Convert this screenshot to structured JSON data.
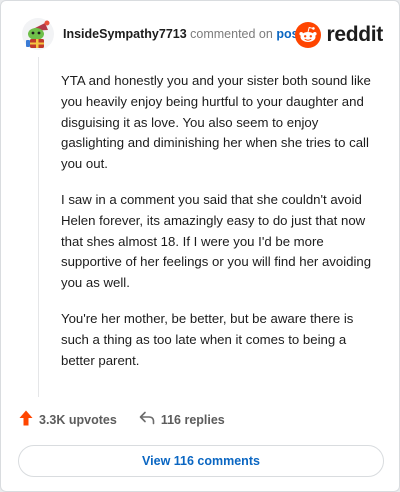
{
  "comment": {
    "username": "InsideSympathy7713",
    "action_text": "commented on",
    "post_link": "post",
    "paragraphs": [
      "YTA and honestly you and your sister both sound like you heavily enjoy being hurtful to your daughter and disguising it as love. You also seem to enjoy gaslighting and diminishing her when she tries to call you out.",
      "I saw in a comment you said that she couldn't avoid Helen forever, its amazingly easy to do just that now that shes almost 18. If I were you I'd be more supportive of her feelings or you will find her avoiding you as well.",
      "You're her mother, be better, but be aware there is such a thing as too late when it comes to being a better parent."
    ]
  },
  "brand": {
    "text": "reddit",
    "color": "#ff4500"
  },
  "actions": {
    "upvotes_label": "3.3K upvotes",
    "replies_label": "116 replies"
  },
  "view_button": {
    "label": "View 116 comments"
  },
  "colors": {
    "upvote": "#ff4500",
    "link": "#0a66c2"
  },
  "icons": {
    "upvote": "upvote-arrow-icon",
    "reply": "reply-arrow-icon",
    "brand": "reddit-snoo-icon"
  }
}
